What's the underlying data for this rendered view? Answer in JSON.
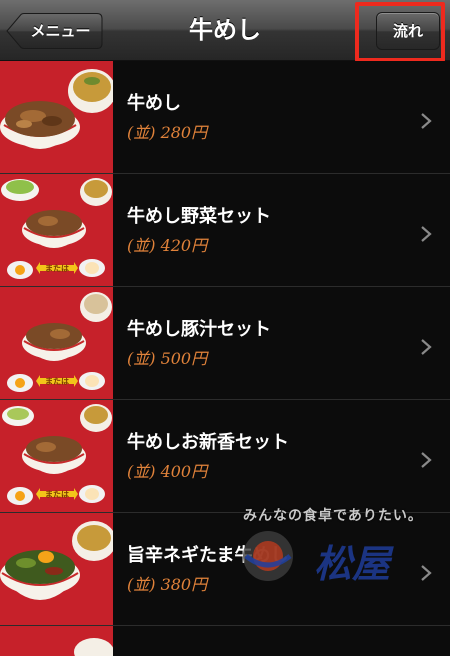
{
  "nav": {
    "back_label": "メニュー",
    "title": "牛めし",
    "right_label": "流れ"
  },
  "items": [
    {
      "name": "牛めし",
      "price": "(並) 280円",
      "image": "gyumeshi-bowl-with-miso"
    },
    {
      "name": "牛めし野菜セット",
      "price": "(並) 420円",
      "image": "gyumeshi-salad-set"
    },
    {
      "name": "牛めし豚汁セット",
      "price": "(並) 500円",
      "image": "gyumeshi-tonjiru-set"
    },
    {
      "name": "牛めしお新香セット",
      "price": "(並) 400円",
      "image": "gyumeshi-oshinko-set"
    },
    {
      "name": "旨辛ネギたま牛めし",
      "price": "(並) 380円",
      "image": "negitama-gyumeshi-bowl"
    }
  ],
  "thumb_badge": "または",
  "watermark": {
    "tagline": "みんなの食卓でありたい。",
    "brand": "松屋"
  },
  "colors": {
    "highlight": "#ee2a1e",
    "price": "#e0823a",
    "thumb_bg": "#c6212a"
  }
}
